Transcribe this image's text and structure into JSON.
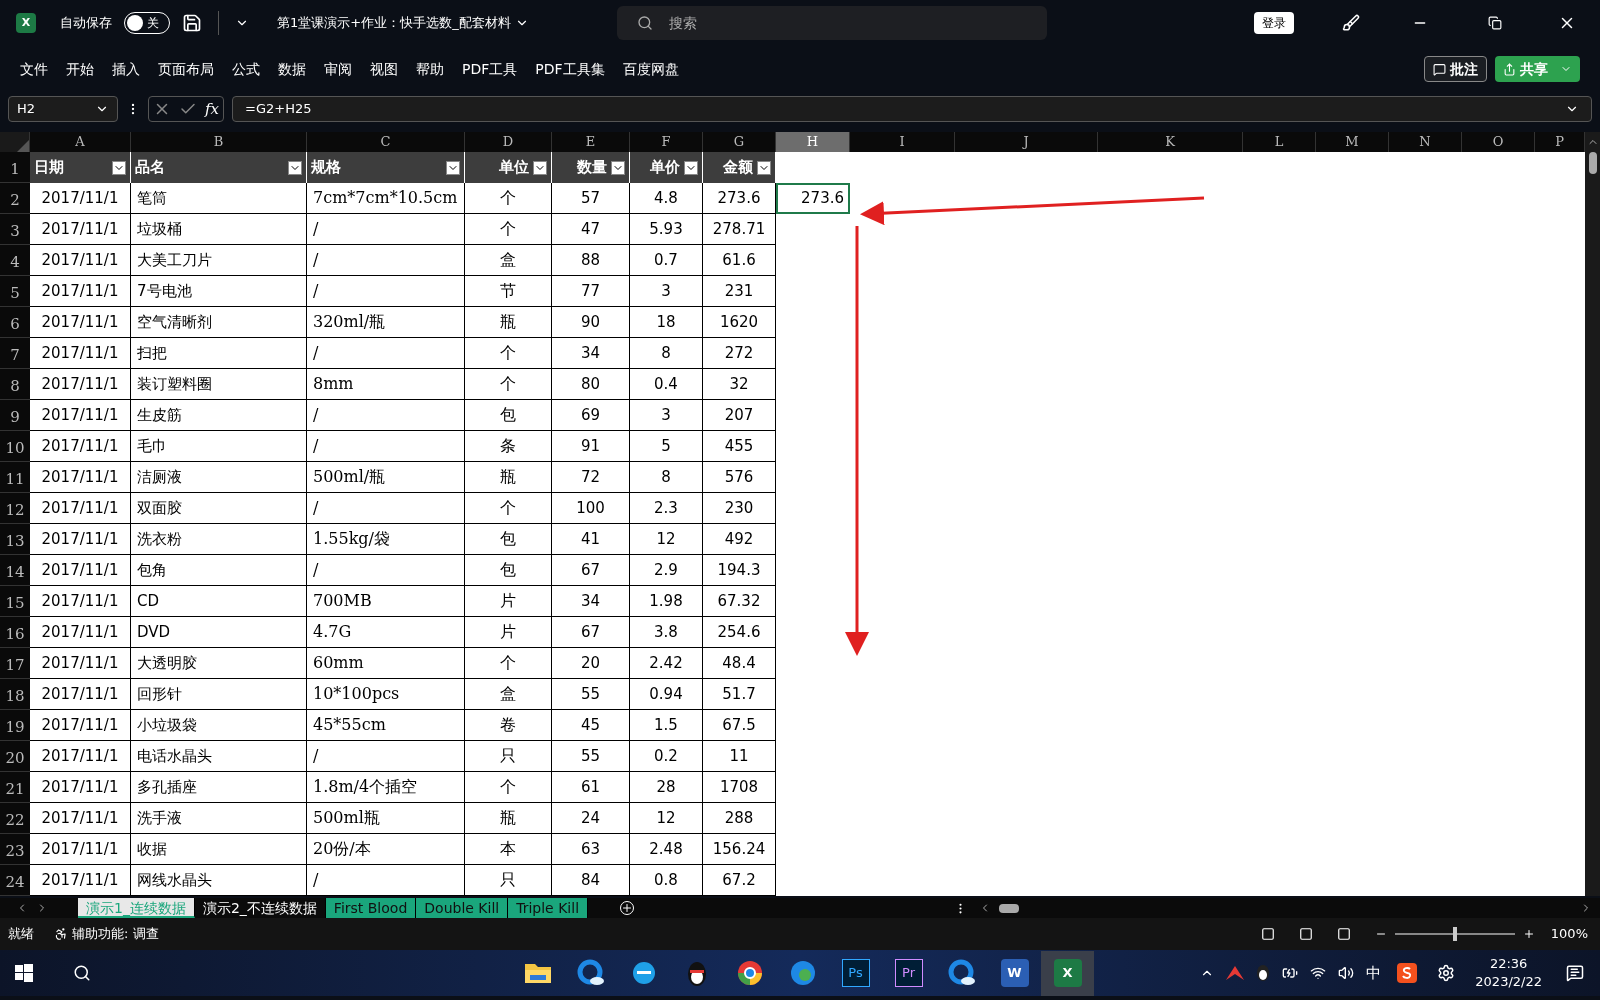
{
  "title_bar": {
    "app_logo": "X",
    "autosave_label": "自动保存",
    "autosave": {
      "on": false,
      "label": "关"
    },
    "document_title": "第1堂课演示+作业：快手选数_配套材料",
    "search": {
      "placeholder": "搜索"
    },
    "login_button": "登录"
  },
  "menu": {
    "items": [
      "文件",
      "开始",
      "插入",
      "页面布局",
      "公式",
      "数据",
      "审阅",
      "视图",
      "帮助",
      "PDF工具",
      "PDF工具集",
      "百度网盘"
    ],
    "comments_button": "批注",
    "share_button": "共享"
  },
  "formula_bar": {
    "name_box": "H2",
    "fx": "fx",
    "formula": "=G2+H25"
  },
  "sheet": {
    "columns": [
      {
        "label": "A",
        "selected": false
      },
      {
        "label": "B",
        "selected": false
      },
      {
        "label": "C",
        "selected": false
      },
      {
        "label": "D",
        "selected": false
      },
      {
        "label": "E",
        "selected": false
      },
      {
        "label": "F",
        "selected": false
      },
      {
        "label": "G",
        "selected": false
      },
      {
        "label": "H",
        "selected": true
      },
      {
        "label": "I",
        "selected": false
      },
      {
        "label": "J",
        "selected": false
      },
      {
        "label": "K",
        "selected": false
      },
      {
        "label": "L",
        "selected": false
      },
      {
        "label": "M",
        "selected": false
      },
      {
        "label": "N",
        "selected": false
      },
      {
        "label": "O",
        "selected": false
      },
      {
        "label": "P",
        "selected": false
      }
    ],
    "header_row": {
      "number": "1",
      "cells": [
        "日期",
        "品名",
        "规格",
        "单位",
        "数量",
        "单价",
        "金额"
      ]
    },
    "rows": [
      {
        "number": "2",
        "cells": [
          "2017/11/1",
          "笔筒",
          "7cm*7cm*10.5cm",
          "个",
          "57",
          "4.8",
          "273.6"
        ],
        "h": "273.6"
      },
      {
        "number": "3",
        "cells": [
          "2017/11/1",
          "垃圾桶",
          "/",
          "个",
          "47",
          "5.93",
          "278.71"
        ]
      },
      {
        "number": "4",
        "cells": [
          "2017/11/1",
          "大美工刀片",
          "/",
          "盒",
          "88",
          "0.7",
          "61.6"
        ]
      },
      {
        "number": "5",
        "cells": [
          "2017/11/1",
          "7号电池",
          "/",
          "节",
          "77",
          "3",
          "231"
        ]
      },
      {
        "number": "6",
        "cells": [
          "2017/11/1",
          "空气清晰剂",
          "320ml/瓶",
          "瓶",
          "90",
          "18",
          "1620"
        ]
      },
      {
        "number": "7",
        "cells": [
          "2017/11/1",
          "扫把",
          "/",
          "个",
          "34",
          "8",
          "272"
        ]
      },
      {
        "number": "8",
        "cells": [
          "2017/11/1",
          "装订塑料圈",
          "8mm",
          "个",
          "80",
          "0.4",
          "32"
        ]
      },
      {
        "number": "9",
        "cells": [
          "2017/11/1",
          "生皮筋",
          "/",
          "包",
          "69",
          "3",
          "207"
        ]
      },
      {
        "number": "10",
        "cells": [
          "2017/11/1",
          "毛巾",
          "/",
          "条",
          "91",
          "5",
          "455"
        ]
      },
      {
        "number": "11",
        "cells": [
          "2017/11/1",
          "洁厕液",
          "500ml/瓶",
          "瓶",
          "72",
          "8",
          "576"
        ]
      },
      {
        "number": "12",
        "cells": [
          "2017/11/1",
          "双面胶",
          "/",
          "个",
          "100",
          "2.3",
          "230"
        ]
      },
      {
        "number": "13",
        "cells": [
          "2017/11/1",
          "洗衣粉",
          "1.55kg/袋",
          "包",
          "41",
          "12",
          "492"
        ]
      },
      {
        "number": "14",
        "cells": [
          "2017/11/1",
          "包角",
          "/",
          "包",
          "67",
          "2.9",
          "194.3"
        ]
      },
      {
        "number": "15",
        "cells": [
          "2017/11/1",
          "CD",
          "700MB",
          "片",
          "34",
          "1.98",
          "67.32"
        ]
      },
      {
        "number": "16",
        "cells": [
          "2017/11/1",
          "DVD",
          "4.7G",
          "片",
          "67",
          "3.8",
          "254.6"
        ]
      },
      {
        "number": "17",
        "cells": [
          "2017/11/1",
          "大透明胶",
          "60mm",
          "个",
          "20",
          "2.42",
          "48.4"
        ]
      },
      {
        "number": "18",
        "cells": [
          "2017/11/1",
          "回形针",
          "10*100pcs",
          "盒",
          "55",
          "0.94",
          "51.7"
        ]
      },
      {
        "number": "19",
        "cells": [
          "2017/11/1",
          "小垃圾袋",
          "45*55cm",
          "卷",
          "45",
          "1.5",
          "67.5"
        ]
      },
      {
        "number": "20",
        "cells": [
          "2017/11/1",
          "电话水晶头",
          "/",
          "只",
          "55",
          "0.2",
          "11"
        ]
      },
      {
        "number": "21",
        "cells": [
          "2017/11/1",
          "多孔插座",
          "1.8m/4个插空",
          "个",
          "61",
          "28",
          "1708"
        ]
      },
      {
        "number": "22",
        "cells": [
          "2017/11/1",
          "洗手液",
          "500ml瓶",
          "瓶",
          "24",
          "12",
          "288"
        ]
      },
      {
        "number": "23",
        "cells": [
          "2017/11/1",
          "收据",
          "20份/本",
          "本",
          "63",
          "2.48",
          "156.24"
        ]
      },
      {
        "number": "24",
        "cells": [
          "2017/11/1",
          "网线水晶头",
          "/",
          "只",
          "84",
          "0.8",
          "67.2"
        ]
      }
    ]
  },
  "sheet_tabs": [
    {
      "label": "演示1_连续数据",
      "selected": true
    },
    {
      "label": "演示2_不连续数据",
      "selected": false
    },
    {
      "label": "First Blood",
      "selected": false,
      "color": "#1aa67c"
    },
    {
      "label": "Double Kill",
      "selected": false,
      "color": "#1aa67c"
    },
    {
      "label": "Triple Kill",
      "selected": false,
      "color": "#1aa67c"
    }
  ],
  "status_bar": {
    "ready": "就绪",
    "accessibility": "辅助功能: 调查",
    "zoom": {
      "level": 0.5,
      "reading": "100%"
    }
  },
  "taskbar": {
    "apps": [
      {
        "kind": "folder"
      },
      {
        "kind": "qbrowser"
      },
      {
        "kind": "ie"
      },
      {
        "kind": "qq"
      },
      {
        "kind": "chrome"
      },
      {
        "kind": "edge"
      },
      {
        "kind": "letter",
        "label": "Ps",
        "color": "#31a8ff"
      },
      {
        "kind": "letter",
        "label": "Pr",
        "color": "#d08cff"
      },
      {
        "kind": "qbrowser"
      },
      {
        "kind": "word",
        "label": "W"
      },
      {
        "kind": "excel",
        "label": "X",
        "selected": true
      }
    ],
    "ime": "中",
    "time": "22:36",
    "date": "2023/2/22"
  }
}
